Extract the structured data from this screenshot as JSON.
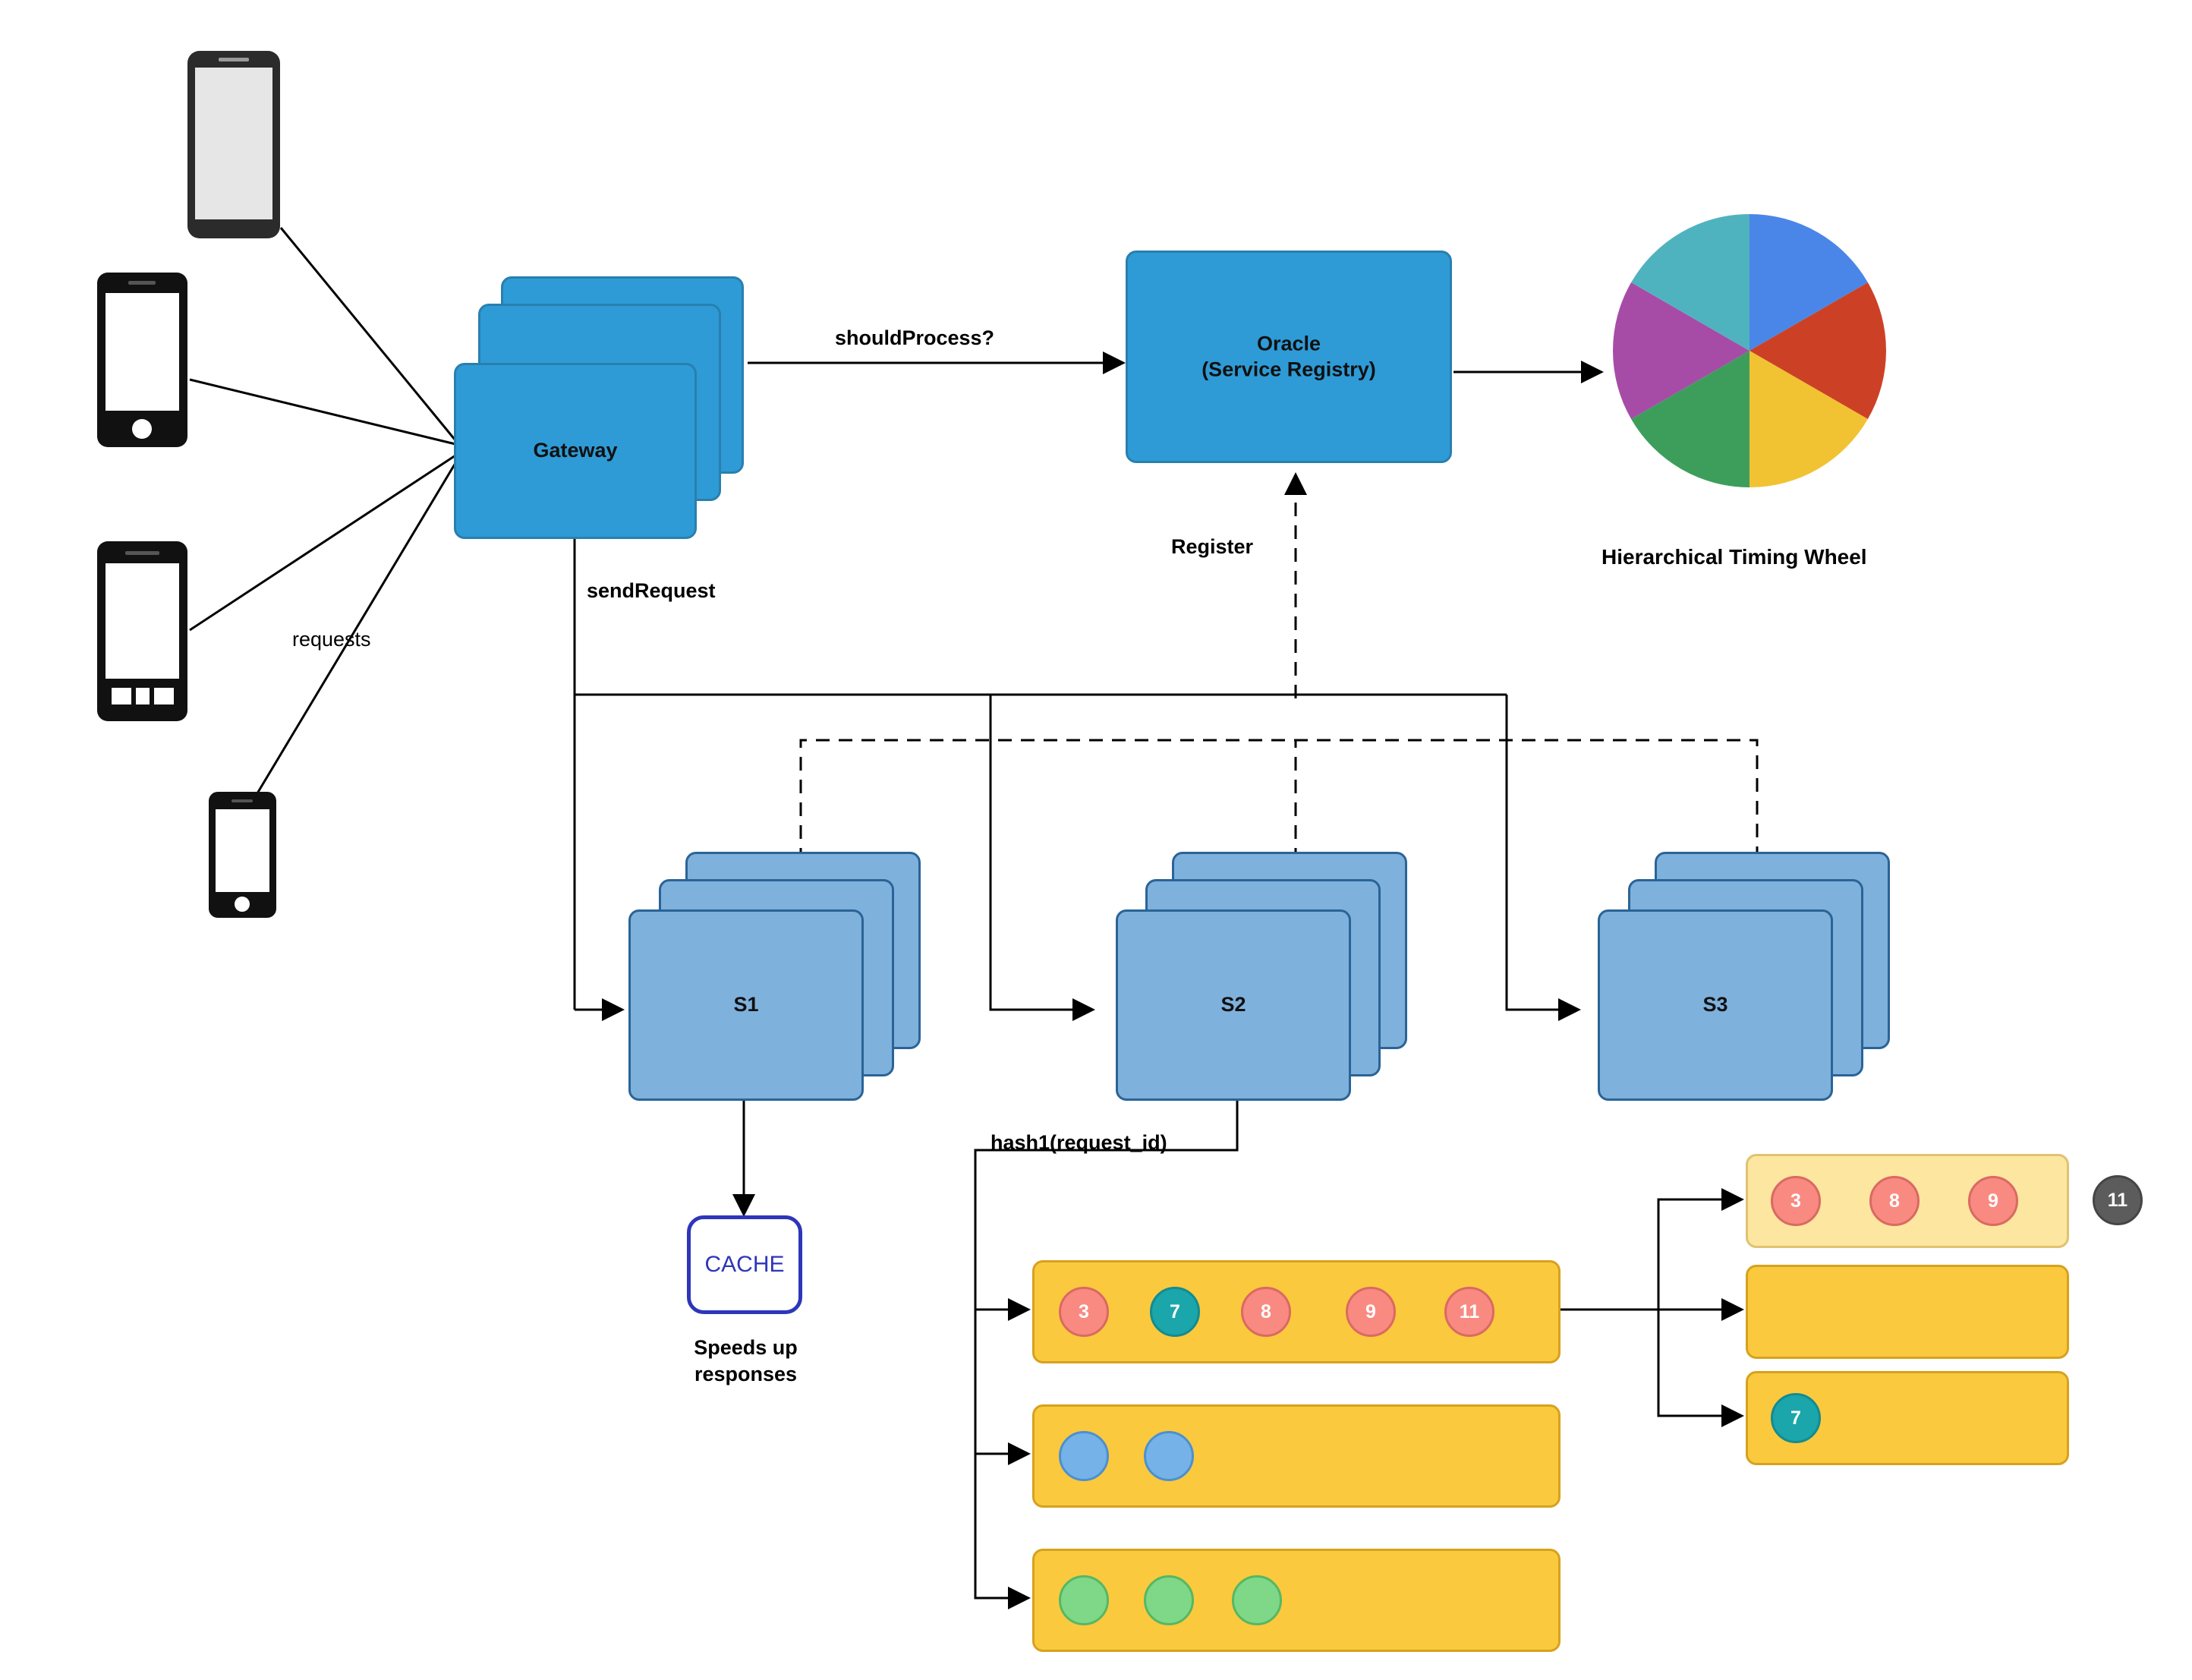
{
  "diagram": {
    "title_labels": {
      "timing_wheel": "Hierarchical Timing Wheel",
      "cache_caption": "Speeds up\nresponses"
    },
    "nodes": {
      "gateway": "Gateway",
      "oracle": "Oracle\n(Service Registry)",
      "oracle_line1": "Oracle",
      "oracle_line2": "(Service Registry)",
      "s1": "S1",
      "s2": "S2",
      "s3": "S3",
      "cache": "CACHE"
    },
    "edges": {
      "requests": "requests",
      "should_process": "shouldProcess?",
      "send_request": "sendRequest",
      "register": "Register",
      "hash1": "hash1(request_id)"
    },
    "cache_caption_line1": "Speeds up",
    "cache_caption_line2": "responses",
    "devices": [
      {
        "name": "tablet-light",
        "kind": "tablet-light"
      },
      {
        "name": "phone-dark-1",
        "kind": "phone-dark"
      },
      {
        "name": "tablet-dark",
        "kind": "tablet-dark"
      },
      {
        "name": "phone-dark-small",
        "kind": "phone-small"
      }
    ],
    "timing_wheel": {
      "slices": [
        {
          "color": "#4a86e8",
          "label": ""
        },
        {
          "color": "#cc4125",
          "label": ""
        },
        {
          "color": "#f1c232",
          "label": ""
        },
        {
          "color": "#3d9e5c",
          "label": ""
        },
        {
          "color": "#a64ca6",
          "label": ""
        },
        {
          "color": "#4fb3bf",
          "label": ""
        }
      ]
    },
    "hash_buckets": [
      {
        "name": "bucket-row-1",
        "items": [
          {
            "value": "3",
            "color": "red"
          },
          {
            "value": "7",
            "color": "teal"
          },
          {
            "value": "8",
            "color": "red"
          },
          {
            "value": "9",
            "color": "red"
          },
          {
            "value": "11",
            "color": "red"
          }
        ]
      },
      {
        "name": "bucket-row-2",
        "items": [
          {
            "value": "",
            "color": "blue"
          },
          {
            "value": "",
            "color": "blue"
          }
        ]
      },
      {
        "name": "bucket-row-3",
        "items": [
          {
            "value": "",
            "color": "green"
          },
          {
            "value": "",
            "color": "green"
          },
          {
            "value": "",
            "color": "green"
          }
        ]
      }
    ],
    "split_buckets": [
      {
        "name": "split-bucket-1",
        "items": [
          {
            "value": "3",
            "color": "red"
          },
          {
            "value": "8",
            "color": "red"
          },
          {
            "value": "9",
            "color": "red"
          }
        ]
      },
      {
        "name": "split-bucket-2",
        "items": []
      },
      {
        "name": "split-bucket-3",
        "items": [
          {
            "value": "7",
            "color": "teal"
          }
        ]
      }
    ],
    "floating_badge": {
      "value": "11",
      "color": "gray"
    },
    "colors": {
      "gateway_fill": "#2e9bd6",
      "service_fill": "#7fb1dd",
      "bucket_fill": "#fbc93d",
      "bucket_light_fill": "#fce6a0",
      "cache_border": "#2d36b8",
      "red_ball": "#f98a81",
      "teal_ball": "#1aa6ab",
      "blue_ball": "#74b2e8",
      "green_ball": "#7ed888",
      "gray_badge": "#5c5c5c"
    }
  }
}
